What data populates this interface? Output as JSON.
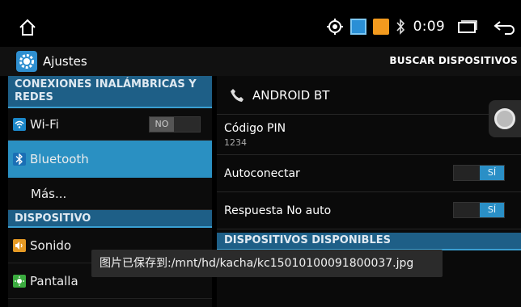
{
  "status_bar": {
    "time": "0:09",
    "icons": [
      "home-icon",
      "gps-icon",
      "cast-icon",
      "camera-app-icon",
      "bluetooth-status-icon",
      "recents-icon",
      "back-icon"
    ],
    "colors": {
      "cast": "#2a8fd6",
      "camera": "#f39a1e"
    }
  },
  "action_bar": {
    "app_icon": "settings-gear-icon",
    "title": "Ajustes",
    "action": "BUSCAR DISPOSITIVOS"
  },
  "left_pane": {
    "section_wireless": "CONEXIONES INALÁMBRICAS Y REDES",
    "items": [
      {
        "label": "Wi-Fi",
        "icon": "wifi-icon",
        "toggle": "NO"
      },
      {
        "label": "Bluetooth",
        "icon": "bluetooth-icon",
        "selected": true
      },
      {
        "label": "Más..."
      }
    ],
    "section_device": "DISPOSITIVO",
    "device_items": [
      {
        "label": "Sonido",
        "icon": "sound-icon"
      },
      {
        "label": "Pantalla",
        "icon": "display-icon"
      }
    ]
  },
  "right_pane": {
    "bt_name": "ANDROID BT",
    "pin_label": "Código PIN",
    "pin_value": "1234",
    "autoconnect_label": "Autoconectar",
    "autoconnect_toggle": "SÍ",
    "auto_answer_label": "Respuesta No auto",
    "auto_answer_toggle": "SÍ",
    "section_available": "DISPOSITIVOS DISPONIBLES"
  },
  "toast": {
    "text": "图片已保存到:/mnt/hd/kacha/kc15010100091800037.jpg"
  },
  "colors": {
    "accent": "#2a90c2",
    "section_header": "#1e5f87",
    "toggle_on": "#2a8fc6"
  }
}
